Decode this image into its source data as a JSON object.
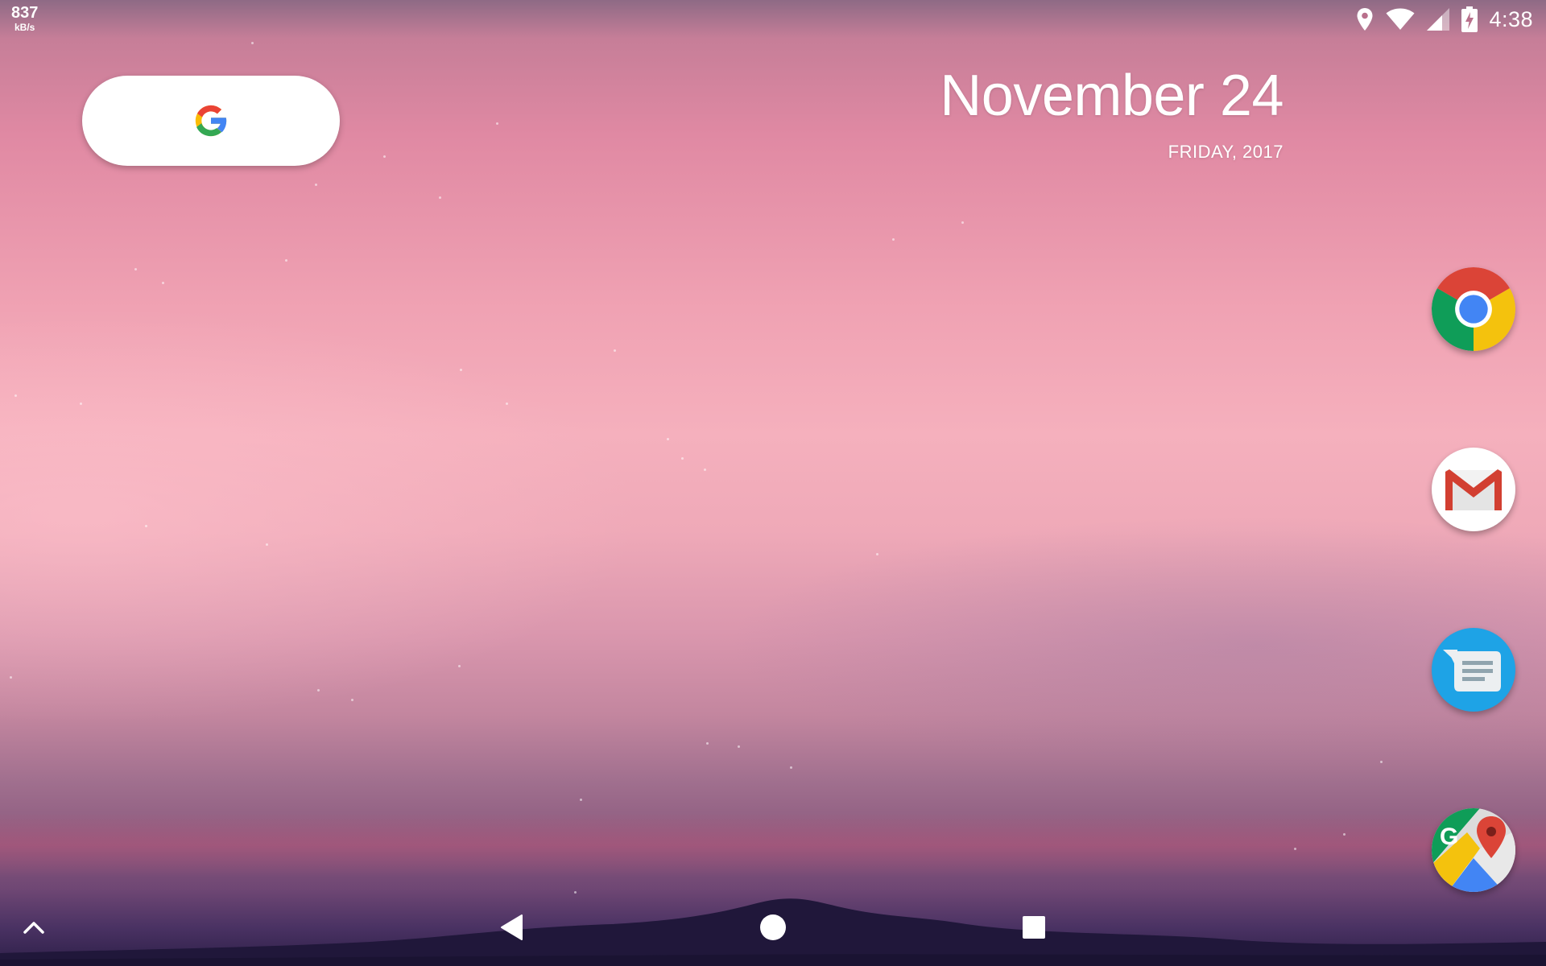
{
  "status_bar": {
    "net_speed_value": "837",
    "net_speed_unit": "kB/s",
    "time": "4:38",
    "icons": [
      "location-icon",
      "wifi-icon",
      "cell-signal-icon",
      "battery-charging-icon"
    ]
  },
  "search_widget": {
    "icon": "google-g-icon"
  },
  "date_widget": {
    "date": "November 24",
    "weekday_year": "FRIDAY, 2017"
  },
  "dock": {
    "apps": [
      {
        "icon": "chrome-icon"
      },
      {
        "icon": "gmail-icon"
      },
      {
        "icon": "messages-icon"
      },
      {
        "icon": "maps-icon"
      }
    ]
  },
  "nav_bar": {
    "buttons": [
      "app-drawer-handle",
      "back-button",
      "home-button",
      "recents-button"
    ]
  },
  "colors": {
    "google_blue": "#4285F4",
    "google_red": "#EA4335",
    "google_yellow": "#FBBC05",
    "google_green": "#34A853",
    "messages_blue": "#1EA3E6"
  }
}
